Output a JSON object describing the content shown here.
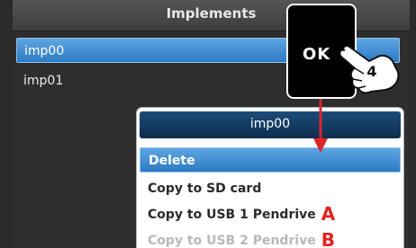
{
  "window": {
    "title": "Implements"
  },
  "implements_list": [
    {
      "label": "imp00"
    },
    {
      "label": "imp01"
    }
  ],
  "ok_button": {
    "label": "OK",
    "step_number": "4"
  },
  "context_menu": {
    "header": "imp00",
    "items": [
      {
        "label": "Delete",
        "state": "selected"
      },
      {
        "label": "Copy to SD card",
        "state": "enabled"
      },
      {
        "label": "Copy to USB 1 Pendrive",
        "state": "enabled",
        "callout": "A"
      },
      {
        "label": "Copy to USB 2 Pendrive",
        "state": "disabled",
        "callout": "B"
      }
    ]
  },
  "colors": {
    "selection": "#2c7ac4",
    "menu_header": "#0e2d4d",
    "callout": "#e02222",
    "arrow": "#d9262c"
  },
  "icons": [
    "pointing-hand-icon",
    "down-arrow-icon"
  ]
}
